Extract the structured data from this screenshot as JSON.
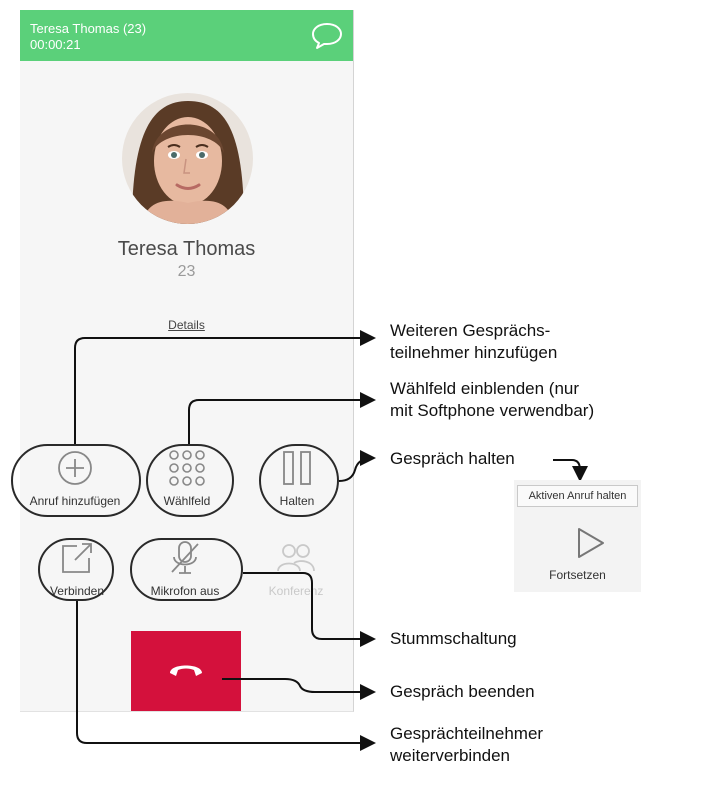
{
  "header": {
    "caller": "Teresa Thomas (23)",
    "duration": "00:00:21",
    "chat_icon": "speech-bubble-icon",
    "color": "#5bd07a"
  },
  "contact": {
    "name": "Teresa Thomas",
    "extension": "23",
    "details_link": "Details"
  },
  "controls": {
    "add_call": {
      "label": "Anruf hinzufügen",
      "icon": "plus-circle-icon"
    },
    "dialpad": {
      "label": "Wählfeld",
      "icon": "dialpad-icon"
    },
    "hold": {
      "label": "Halten",
      "icon": "pause-icon"
    },
    "transfer": {
      "label": "Verbinden",
      "icon": "transfer-icon"
    },
    "mute": {
      "label": "Mikrofon aus",
      "icon": "mic-off-icon"
    },
    "conference": {
      "label": "Konferenz",
      "icon": "users-icon",
      "enabled": false
    },
    "hangup": {
      "icon": "phone-hangup-icon",
      "color": "#d4113c"
    }
  },
  "annotations": {
    "add_participant": [
      "Weiteren Gesprächs-",
      "teilnehmer hinzufügen"
    ],
    "show_dialpad": [
      "Wählfeld einblenden (nur",
      "mit Softphone verwendbar)"
    ],
    "hold_call": "Gespräch halten",
    "mute": "Stummschaltung",
    "end_call": "Gespräch beenden",
    "transfer": [
      "Gesprächteilnehmer",
      "weiterverbinden"
    ]
  },
  "hold_preview": {
    "tooltip": "Aktiven Anruf halten",
    "resume_label": "Fortsetzen",
    "icon": "play-icon"
  }
}
